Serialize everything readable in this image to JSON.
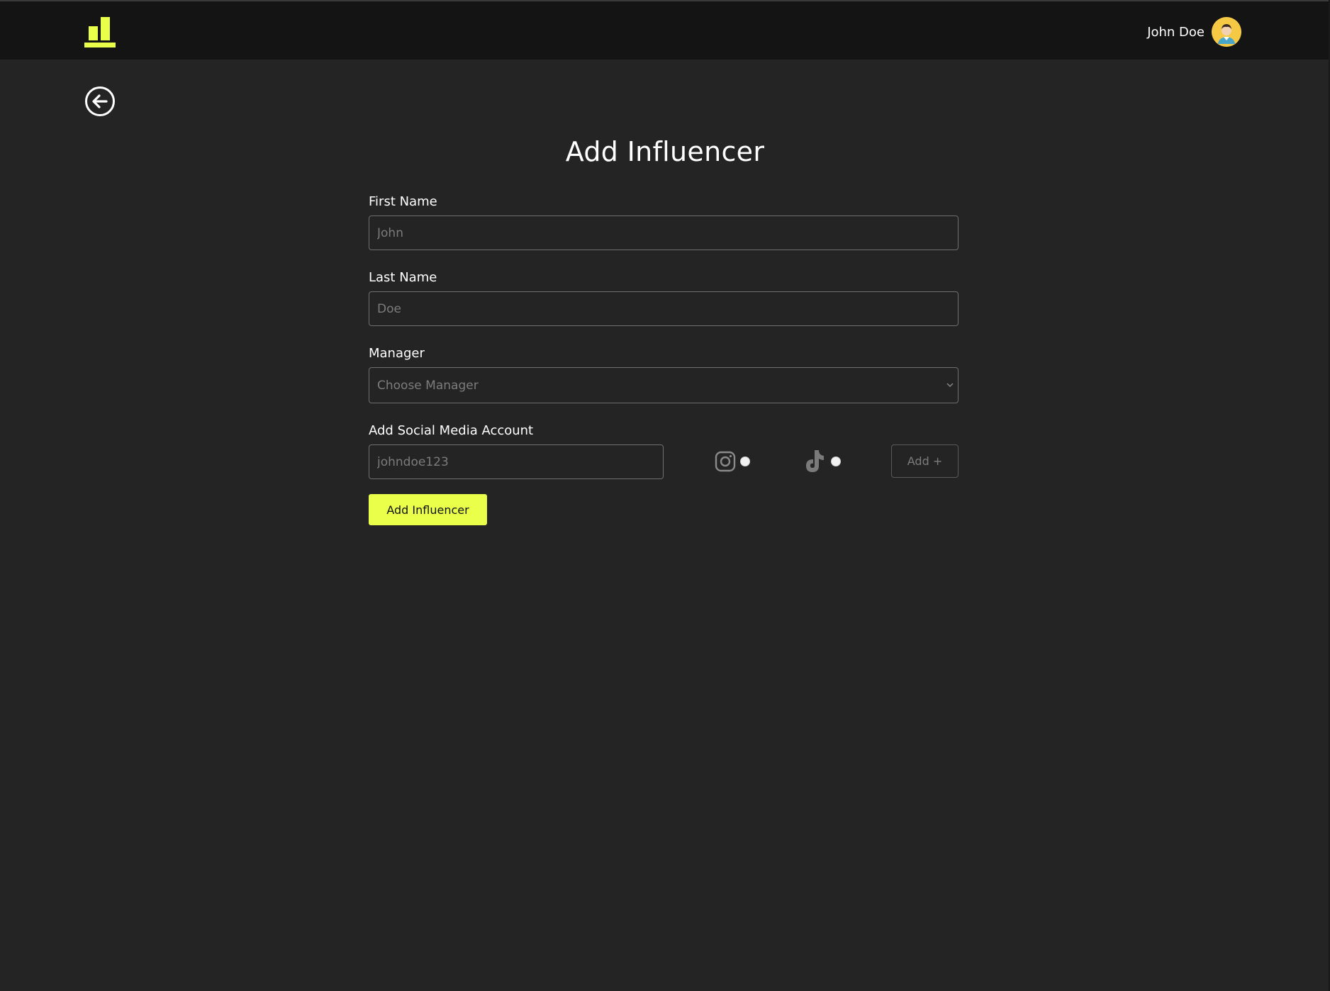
{
  "header": {
    "user_name": "John Doe",
    "brand_color": "#eaff4a"
  },
  "page": {
    "title": "Add Influencer"
  },
  "form": {
    "first_name": {
      "label": "First Name",
      "placeholder": "John",
      "value": ""
    },
    "last_name": {
      "label": "Last Name",
      "placeholder": "Doe",
      "value": ""
    },
    "manager": {
      "label": "Manager",
      "selected": "Choose Manager"
    },
    "social": {
      "label": "Add Social Media Account",
      "placeholder": "johndoe123",
      "value": "",
      "platforms": [
        {
          "name": "instagram",
          "icon": "instagram-icon",
          "selected": false
        },
        {
          "name": "tiktok",
          "icon": "tiktok-icon",
          "selected": false
        }
      ],
      "add_label": "Add +"
    },
    "submit_label": "Add Influencer"
  }
}
